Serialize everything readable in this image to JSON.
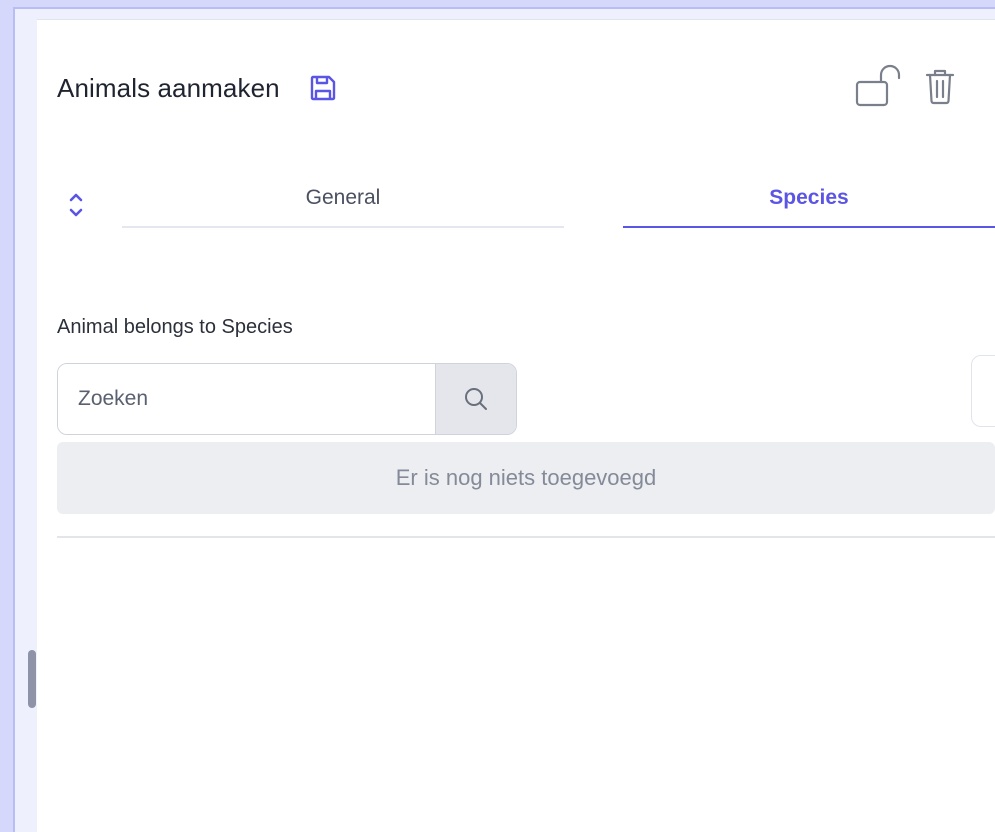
{
  "header": {
    "title": "Animals aanmaken",
    "icons": [
      "save-icon",
      "unlock-icon",
      "trash-icon"
    ]
  },
  "tabs": [
    {
      "label": "General",
      "active": false
    },
    {
      "label": "Species",
      "active": true
    }
  ],
  "tab_toggle_icon": "chevron-up-down-icon",
  "relation": {
    "label": "Animal belongs to Species",
    "search": {
      "placeholder": "Zoeken",
      "value": "",
      "button_icon": "search-icon"
    },
    "empty_message": "Er is nog niets toegevoegd"
  },
  "colors": {
    "accent": "#5b55e6",
    "frame": "#d6d8fb"
  }
}
